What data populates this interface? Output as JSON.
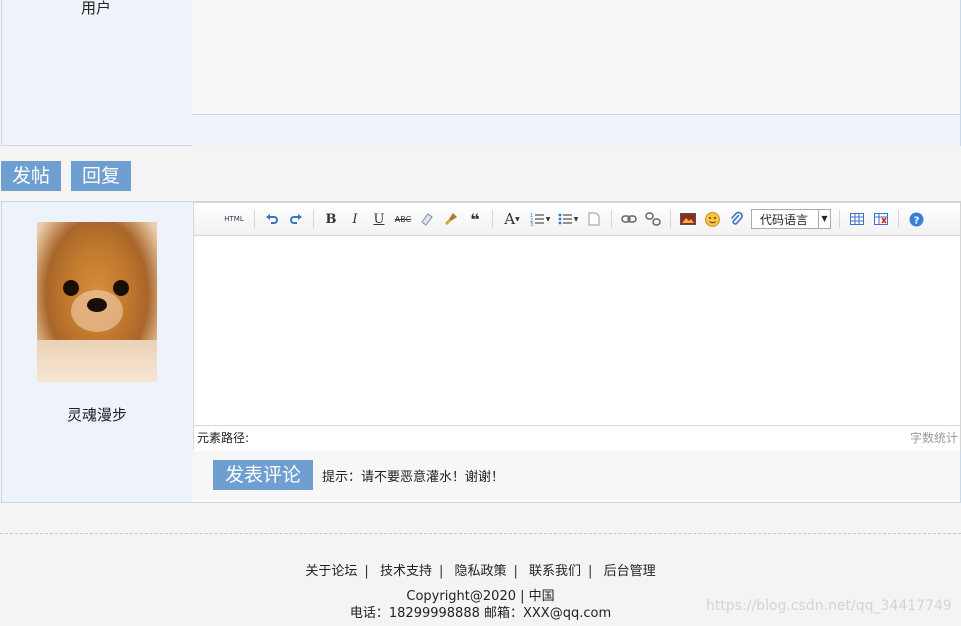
{
  "top_post": {
    "user_label": "用户"
  },
  "actions": {
    "post_label": "发帖",
    "reply_label": "回复"
  },
  "reply": {
    "username": "灵魂漫步"
  },
  "editor": {
    "toolbar": {
      "html_label": "HTML",
      "bold": "B",
      "italic": "I",
      "underline": "U",
      "strike": "ABC",
      "quote": "❝",
      "font_color": "A",
      "code_language": "代码语言",
      "icons": [
        "html-icon",
        "undo-icon",
        "redo-icon",
        "bold-icon",
        "italic-icon",
        "underline-icon",
        "strikethrough-icon",
        "eraser-icon",
        "format-brush-icon",
        "blockquote-icon",
        "font-color-icon",
        "ordered-list-icon",
        "unordered-list-icon",
        "page-icon",
        "link-icon",
        "unlink-icon",
        "image-icon",
        "emoji-icon",
        "attachment-icon",
        "code-language-select",
        "table-icon",
        "delete-table-icon",
        "help-icon"
      ]
    },
    "path_label": "元素路径:",
    "word_count": "字数统计"
  },
  "submit": {
    "label": "发表评论",
    "hint": "提示：请不要恶意灌水！谢谢！"
  },
  "footer": {
    "links": [
      "关于论坛",
      "技术支持",
      "隐私政策",
      "联系我们",
      "后台管理"
    ],
    "copyright": "Copyright@2020 | 中国",
    "contact": "电话：18299998888 邮箱：XXX@qq.com",
    "watermark": "https://blog.csdn.net/qq_34417749"
  },
  "colors": {
    "accent": "#6f9fd1",
    "panel": "#eef3fb",
    "border": "#c8d8e8"
  }
}
